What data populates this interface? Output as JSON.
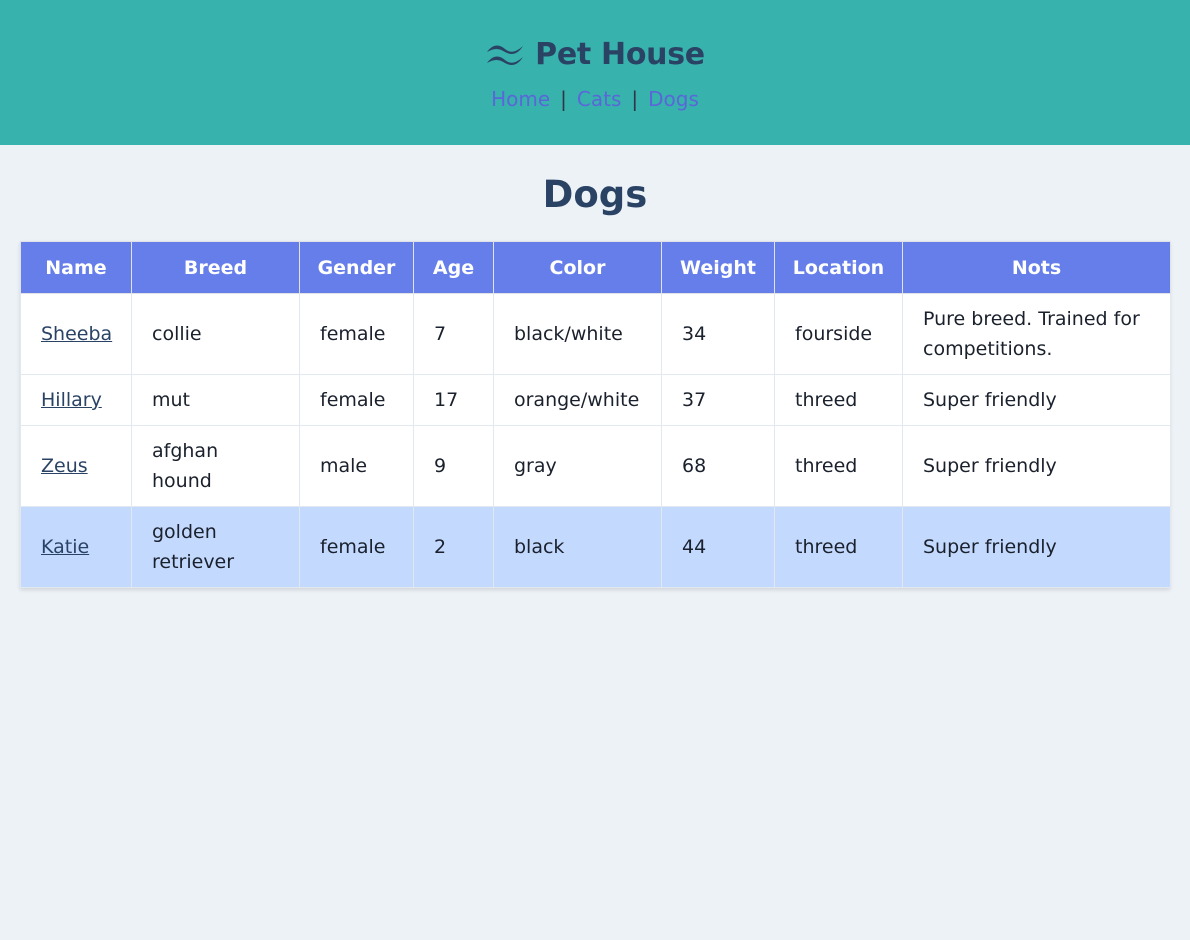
{
  "header": {
    "brand_icon": "wave-logo-icon",
    "title": "Pet House",
    "nav": [
      {
        "label": "Home"
      },
      {
        "label": "Cats"
      },
      {
        "label": "Dogs"
      }
    ],
    "separator": "|"
  },
  "page": {
    "title": "Dogs"
  },
  "table": {
    "columns": [
      "Name",
      "Breed",
      "Gender",
      "Age",
      "Color",
      "Weight",
      "Location",
      "Nots"
    ],
    "rows": [
      {
        "name": "Sheeba",
        "breed": "collie",
        "gender": "female",
        "age": "7",
        "color": "black/white",
        "weight": "34",
        "location": "fourside",
        "notes": "Pure breed. Trained for competitions."
      },
      {
        "name": "Hillary",
        "breed": "mut",
        "gender": "female",
        "age": "17",
        "color": "orange/white",
        "weight": "37",
        "location": "threed",
        "notes": "Super friendly"
      },
      {
        "name": "Zeus",
        "breed": "afghan hound",
        "gender": "male",
        "age": "9",
        "color": "gray",
        "weight": "68",
        "location": "threed",
        "notes": "Super friendly"
      },
      {
        "name": "Katie",
        "breed": "golden retriever",
        "gender": "female",
        "age": "2",
        "color": "black",
        "weight": "44",
        "location": "threed",
        "notes": "Super friendly"
      }
    ]
  },
  "colors": {
    "header_bg": "#38b2ac",
    "title": "#2a4365",
    "nav_link": "#5a67d8",
    "table_header_bg": "#667eea",
    "highlight_row_bg": "#c3dafe",
    "page_bg": "#edf2f7"
  }
}
